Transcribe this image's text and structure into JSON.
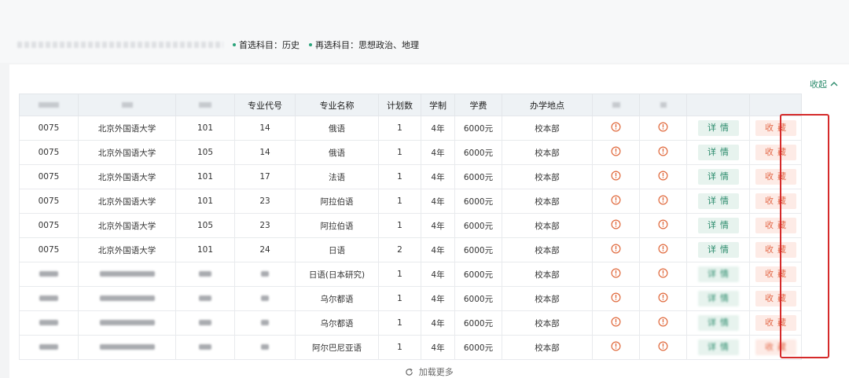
{
  "subjects": {
    "first_label": "首选科目：历史",
    "second_label": "再选科目：思想政治、地理"
  },
  "collapse_label": "收起",
  "collapse_icon": "chevron-up-icon",
  "headers": [
    "专业代号",
    "专业名称",
    "计划数",
    "学制",
    "学费",
    "办学地点"
  ],
  "rows": [
    {
      "code": "0075",
      "school": "北京外国语大学",
      "group": "101",
      "major_code": "14",
      "major": "俄语",
      "plan": "1",
      "years": "4年",
      "fee": "6000元",
      "campus": "校本部"
    },
    {
      "code": "0075",
      "school": "北京外国语大学",
      "group": "105",
      "major_code": "14",
      "major": "俄语",
      "plan": "1",
      "years": "4年",
      "fee": "6000元",
      "campus": "校本部"
    },
    {
      "code": "0075",
      "school": "北京外国语大学",
      "group": "101",
      "major_code": "17",
      "major": "法语",
      "plan": "1",
      "years": "4年",
      "fee": "6000元",
      "campus": "校本部"
    },
    {
      "code": "0075",
      "school": "北京外国语大学",
      "group": "101",
      "major_code": "23",
      "major": "阿拉伯语",
      "plan": "1",
      "years": "4年",
      "fee": "6000元",
      "campus": "校本部"
    },
    {
      "code": "0075",
      "school": "北京外国语大学",
      "group": "105",
      "major_code": "23",
      "major": "阿拉伯语",
      "plan": "1",
      "years": "4年",
      "fee": "6000元",
      "campus": "校本部"
    },
    {
      "code": "0075",
      "school": "北京外国语大学",
      "group": "101",
      "major_code": "24",
      "major": "日语",
      "plan": "2",
      "years": "4年",
      "fee": "6000元",
      "campus": "校本部"
    },
    {
      "code": "",
      "school": "",
      "group": "",
      "major_code": "",
      "major": "日语(日本研究)",
      "plan": "1",
      "years": "4年",
      "fee": "6000元",
      "campus": "校本部"
    },
    {
      "code": "",
      "school": "",
      "group": "",
      "major_code": "",
      "major": "乌尔都语",
      "plan": "1",
      "years": "4年",
      "fee": "6000元",
      "campus": "校本部"
    },
    {
      "code": "",
      "school": "",
      "group": "",
      "major_code": "",
      "major": "乌尔都语",
      "plan": "1",
      "years": "4年",
      "fee": "6000元",
      "campus": "校本部"
    },
    {
      "code": "",
      "school": "",
      "group": "",
      "major_code": "",
      "major": "阿尔巴尼亚语",
      "plan": "1",
      "years": "4年",
      "fee": "6000元",
      "campus": "校本部"
    }
  ],
  "actions": {
    "detail_label": "详情",
    "favorite_label": "收藏"
  },
  "load_more_label": "加载更多",
  "load_more_icon": "refresh-icon",
  "info_icon": "info-circle-icon",
  "colors": {
    "accent_green": "#2a8a6b",
    "favorite_red": "#e46a4a",
    "info_icon": "#e0693c",
    "highlight_border": "#d52a2a"
  }
}
